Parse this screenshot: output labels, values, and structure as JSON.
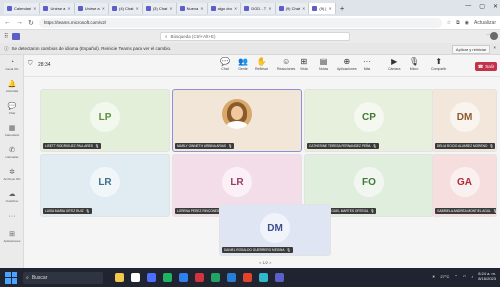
{
  "browser": {
    "tabs": [
      {
        "label": "Calendari",
        "active": false
      },
      {
        "label": "Unirse a",
        "active": false
      },
      {
        "label": "Unirse a",
        "active": false
      },
      {
        "label": "(4) Chat",
        "active": false
      },
      {
        "label": "(3) Chat",
        "active": false
      },
      {
        "label": "Nueva",
        "active": false
      },
      {
        "label": "algo dro",
        "active": false
      },
      {
        "label": "DGD ‑ T",
        "active": false
      },
      {
        "label": "(9) Chat",
        "active": false
      },
      {
        "label": "(9) |",
        "active": true
      }
    ],
    "new_tab": "+",
    "url": "https://teams.microsoft.com/v2/",
    "update_label": "Actualizar"
  },
  "teams": {
    "search_placeholder": "Búsqueda (Ctrl+Alt+E)",
    "more": "···"
  },
  "notice": {
    "text": "Se detectaron cambios de idioma (Español). Reinicie Teams para ver el cambio.",
    "apply": "Aplicar y reiniciar",
    "close": "×"
  },
  "rail": [
    {
      "label": "Canal Ofc",
      "icon": "activity-icon"
    },
    {
      "label": "Actividad",
      "icon": "bell-icon"
    },
    {
      "label": "Chat",
      "icon": "chat-icon"
    },
    {
      "label": "Calendario",
      "icon": "calendar-icon"
    },
    {
      "label": "Llamadas",
      "icon": "phone-icon"
    },
    {
      "label": "Archivos Ofc",
      "icon": "files-icon"
    },
    {
      "label": "OneDrive",
      "icon": "cloud-icon"
    },
    {
      "label": "",
      "icon": "more-icon"
    },
    {
      "label": "Aplicaciones",
      "icon": "apps-icon"
    }
  ],
  "meeting": {
    "time": "28:34",
    "controls": [
      {
        "label": "Chat",
        "glyph": "💬"
      },
      {
        "label": "Gente",
        "glyph": "👥"
      },
      {
        "label": "Reflrisar",
        "glyph": "✋"
      },
      {
        "label": "Reacciones",
        "glyph": "☺"
      },
      {
        "label": "Vista",
        "glyph": "⊞"
      },
      {
        "label": "Notas",
        "glyph": "▤"
      },
      {
        "label": "Aplicaciones",
        "glyph": "⊕"
      },
      {
        "label": "Más",
        "glyph": "···"
      },
      {
        "label": "Cámara",
        "glyph": "▶"
      },
      {
        "label": "Micro",
        "glyph": "🎙"
      },
      {
        "label": "Compartir",
        "glyph": "⬆"
      }
    ],
    "leave_label": "Salir",
    "pager": "< 1/2 >"
  },
  "participants": [
    {
      "initials": "LP",
      "name": "LISETT RODRIGUEZ PALLARES",
      "color": "#5b8f3a",
      "bg": "#e3efd9"
    },
    {
      "initials": "",
      "name": "MARLY GINNETH URBINA ARIAS",
      "photo": true,
      "bg": "#f1e6d8"
    },
    {
      "initials": "CP",
      "name": "CATHERINE TERESA FERNANDEZ PEÑA",
      "color": "#3f7a2f",
      "bg": "#e6f0dd"
    },
    {
      "initials": "DM",
      "name": "DELIA ROCIO ALVAREZ MORENO",
      "color": "#8a5a2e",
      "bg": "#f3e7dc"
    },
    {
      "initials": "LR",
      "name": "LUISA MARIA ORTIZ RUIZ",
      "color": "#3f6f8f",
      "bg": "#e1ebf2"
    },
    {
      "initials": "LR",
      "name": "LORENA PEREZ RINCONES",
      "color": "#9a3d6b",
      "bg": "#f3dde8"
    },
    {
      "initials": "FO",
      "name": "FERNANDO MIGUEL MARTES ORTEGA",
      "color": "#3e7a3a",
      "bg": "#dfeedd"
    },
    {
      "initials": "GA",
      "name": "GABRIELA ANDREA MONTIEL AGUL",
      "color": "#b02a36",
      "bg": "#f6dede"
    },
    {
      "initials": "DM",
      "name": "DANIEL ROSALDO GUERRERO MEDINA",
      "color": "#3b4f8f",
      "bg": "#dfe5f3"
    }
  ],
  "taskbar": {
    "search": "Buscar",
    "weather": "27°C",
    "time": "8:24 a. m.",
    "date": "8/16/2023"
  }
}
